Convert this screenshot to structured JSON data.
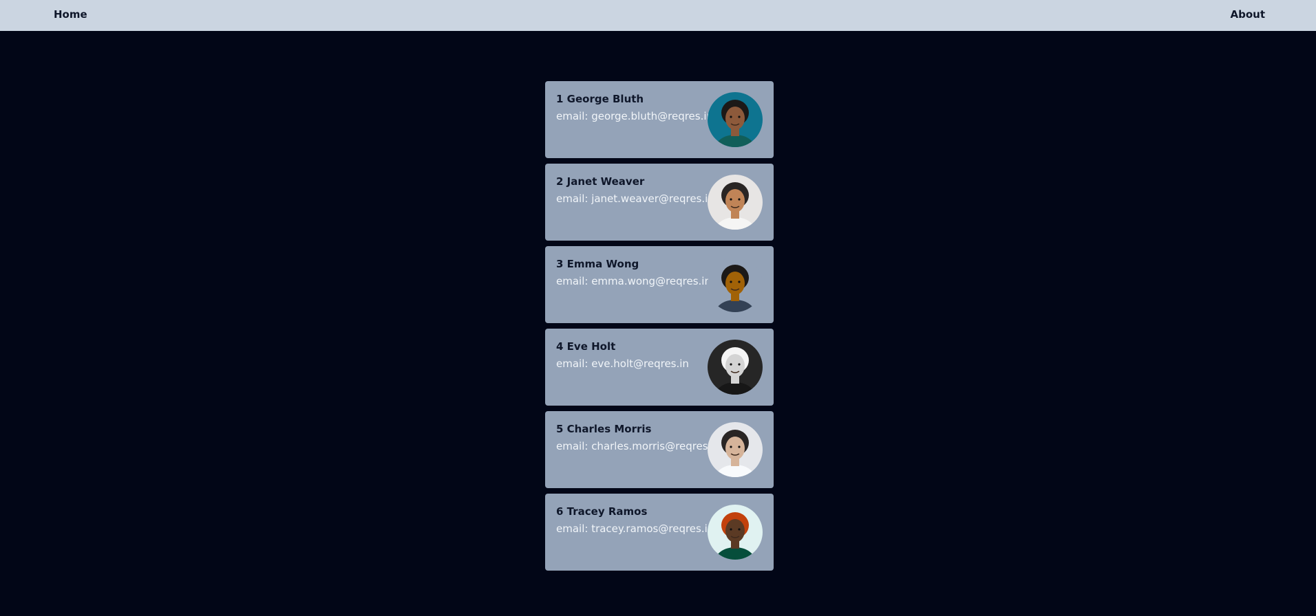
{
  "nav": {
    "home_label": "Home",
    "about_label": "About"
  },
  "users": [
    {
      "id": "1",
      "name": "George Bluth",
      "email_label": "email: george.bluth@reqres.in",
      "avatar_bg": "#0e7490",
      "skin": "#8d5a3b",
      "hair": "#1c1917",
      "shirt": "#115e59"
    },
    {
      "id": "2",
      "name": "Janet Weaver",
      "email_label": "email: janet.weaver@reqres.in",
      "avatar_bg": "#e7e5e4",
      "skin": "#c08457",
      "hair": "#292524",
      "shirt": "#f5f5f4"
    },
    {
      "id": "3",
      "name": "Emma Wong",
      "email_label": "email: emma.wong@reqres.in",
      "avatar_bg": "#94a3b8",
      "skin": "#a16207",
      "hair": "#1c1917",
      "shirt": "#334155"
    },
    {
      "id": "4",
      "name": "Eve Holt",
      "email_label": "email: eve.holt@reqres.in",
      "avatar_bg": "#262626",
      "skin": "#d4d4d4",
      "hair": "#f5f5f5",
      "shirt": "#171717"
    },
    {
      "id": "5",
      "name": "Charles Morris",
      "email_label": "email: charles.morris@reqres.in",
      "avatar_bg": "#e5e7eb",
      "skin": "#d6b49a",
      "hair": "#292524",
      "shirt": "#f8fafc"
    },
    {
      "id": "6",
      "name": "Tracey Ramos",
      "email_label": "email: tracey.ramos@reqres.in",
      "avatar_bg": "#e0f2f1",
      "skin": "#5b3a24",
      "hair": "#c2410c",
      "shirt": "#064e3b"
    }
  ]
}
